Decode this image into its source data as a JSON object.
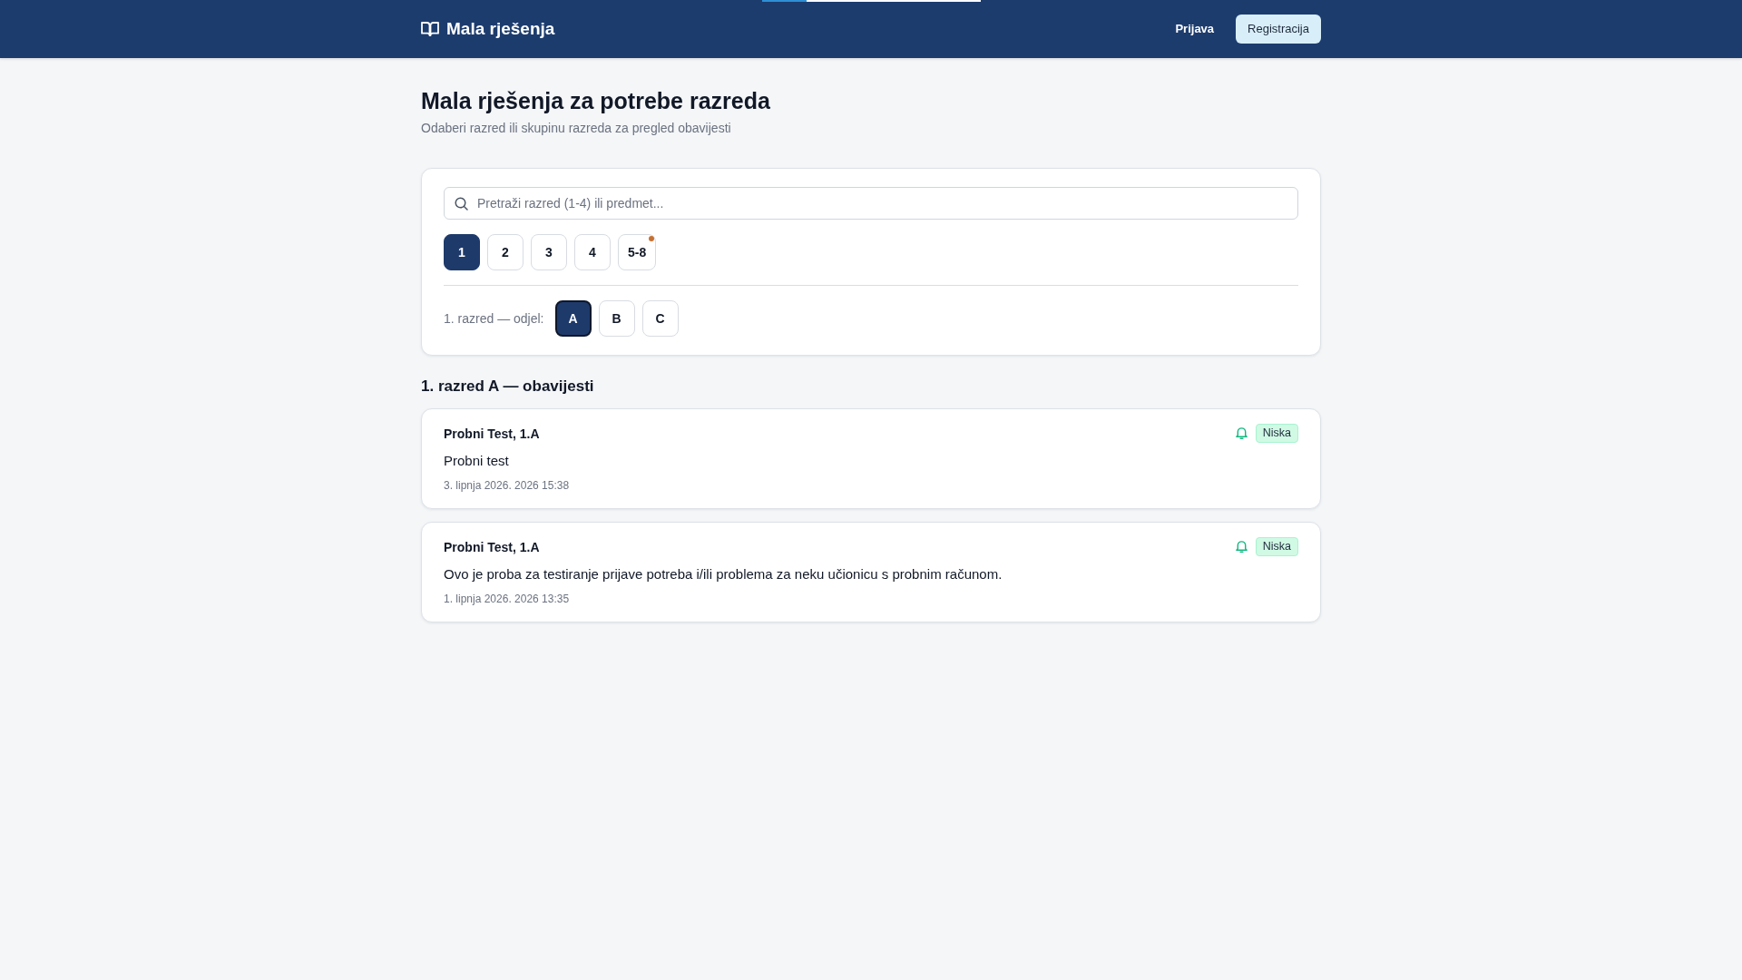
{
  "navbar": {
    "brand": "Mala rješenja",
    "links": [
      {
        "label": "Prijava",
        "kind": "link"
      },
      {
        "label": "Registracija",
        "kind": "button"
      }
    ]
  },
  "page": {
    "title": "Mala rješenja za potrebe razreda",
    "subtitle": "Odaberi razred ili skupinu razreda za pregled obavijesti"
  },
  "filters": {
    "search": {
      "placeholder": "Pretraži razred (1-4) ili predmet..."
    },
    "grades": [
      {
        "label": "1",
        "selected": true,
        "notification": false
      },
      {
        "label": "2",
        "selected": false,
        "notification": false
      },
      {
        "label": "3",
        "selected": false,
        "notification": false
      },
      {
        "label": "4",
        "selected": false,
        "notification": false
      },
      {
        "label": "5-8",
        "selected": false,
        "notification": true
      }
    ],
    "sections": {
      "label": "1. razred — odjel:",
      "items": [
        {
          "label": "A",
          "selected": true
        },
        {
          "label": "B",
          "selected": false
        },
        {
          "label": "C",
          "selected": false
        }
      ]
    }
  },
  "announcements": {
    "title": "1. razred A — obavijesti",
    "items": [
      {
        "author": "Probni Test, 1.A",
        "priority": "Niska",
        "text": "Probni test",
        "date": "3. lipnja 2026. 2026 15:38"
      },
      {
        "author": "Probni Test, 1.A",
        "priority": "Niska",
        "text": "Ovo je proba za testiranje prijave potreba i/ili problema za neku učionicu s probnim računom.",
        "date": "1. lipnja 2026. 2026 13:35"
      }
    ]
  }
}
